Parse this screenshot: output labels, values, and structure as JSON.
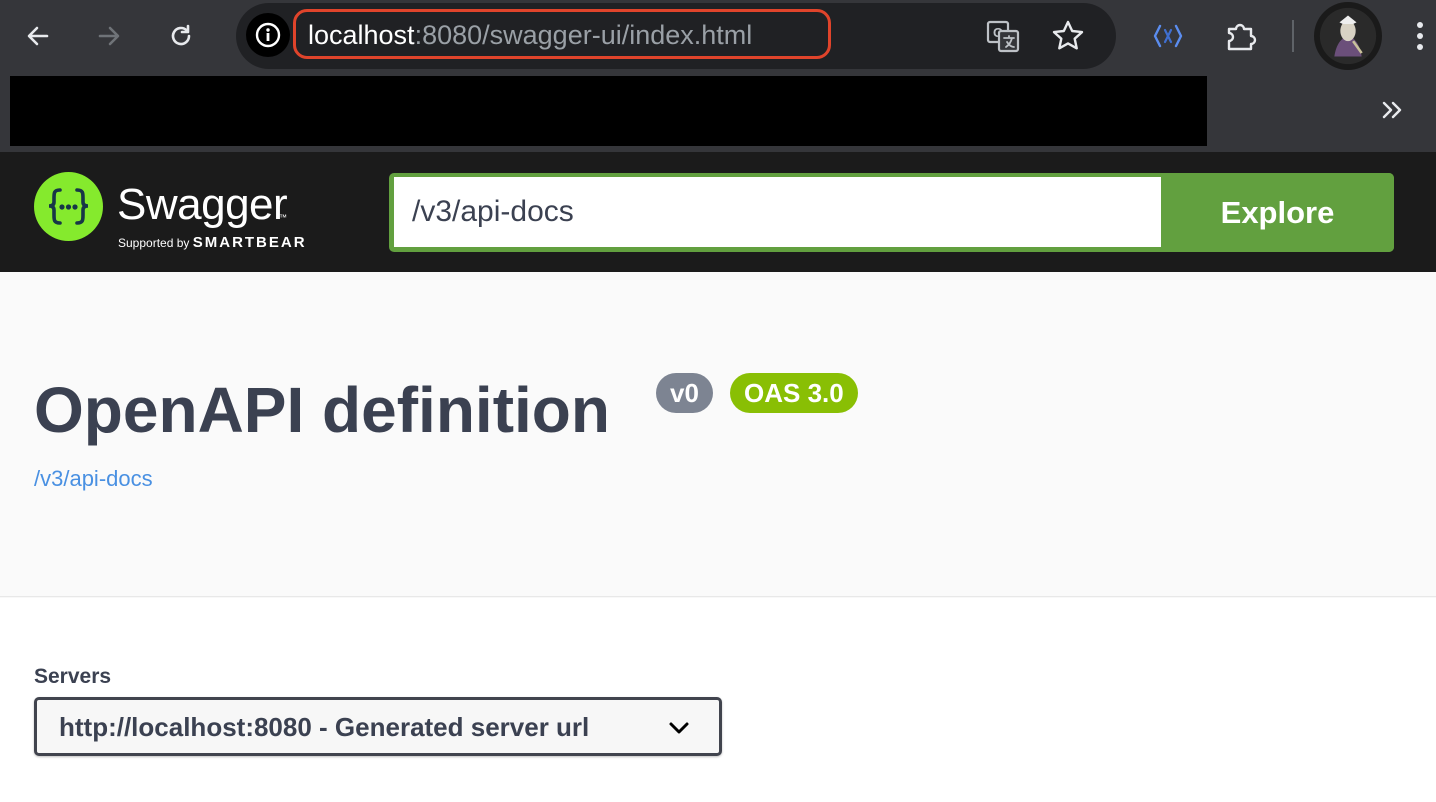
{
  "browser": {
    "url_host": "localhost",
    "url_rest": ":8080/swagger-ui/index.html",
    "icons": {
      "back": "back-arrow-icon",
      "forward": "forward-arrow-icon",
      "reload": "reload-icon",
      "site_info": "info-icon",
      "translate": "translate-icon",
      "bookmark": "star-icon",
      "extension_devtools": "code-brackets-icon",
      "extensions": "puzzle-icon",
      "menu": "kebab-menu-icon",
      "bookmarks_overflow": "double-chevron-right-icon"
    },
    "highlight_color": "#e0442b"
  },
  "topbar": {
    "logo_title": "Swagger",
    "logo_tm": "™",
    "logo_supported": "Supported by",
    "logo_company": "SMARTBEAR",
    "search_value": "/v3/api-docs",
    "explore_label": "Explore",
    "accent_color": "#62a03f"
  },
  "info": {
    "title": "OpenAPI definition",
    "version_badge": "v0",
    "oas_badge": "OAS 3.0",
    "spec_link": "/v3/api-docs"
  },
  "servers": {
    "label": "Servers",
    "selected": "http://localhost:8080 - Generated server url"
  }
}
